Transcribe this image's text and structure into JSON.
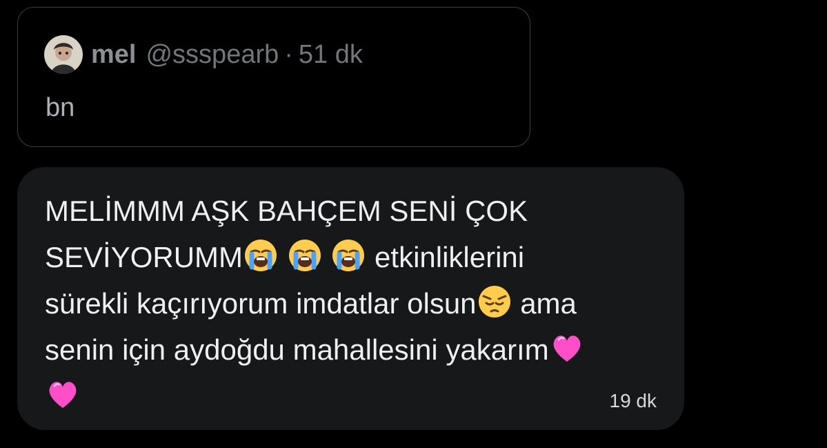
{
  "quoted_tweet": {
    "author_name": "mel",
    "author_handle": "@ssspearb",
    "separator": "·",
    "time": "51 dk",
    "text": "bn"
  },
  "message": {
    "lines": [
      "MELİMMM AŞK BAHÇEM SENİ ÇOK",
      "SEVİYORUMM",
      " etkinliklerini",
      "sürekli kaçırıyorum imdatlar olsun",
      " ama",
      "senin için aydoğdu mahallesini yakarım"
    ],
    "emojis": [
      "crying-face-emoji",
      "crying-face-emoji",
      "crying-face-emoji",
      "pensive-face-emoji",
      "pink-heart-emoji",
      "pink-heart-emoji"
    ],
    "time": "19 dk"
  },
  "colors": {
    "background": "#000000",
    "bubble": "#17181a",
    "quoted_border": "#3a3d42",
    "secondary_text": "#71767b",
    "heart": "#ff4fc8"
  }
}
